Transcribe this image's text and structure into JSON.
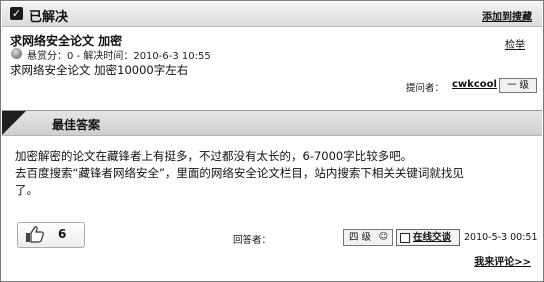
{
  "resolved": {
    "title": "已解决",
    "add_link": "添加到搜藏"
  },
  "question": {
    "title": "求网络安全论文  加密",
    "report_link": "检举",
    "meta": "悬赏分：0 - 解决时间：2010-6-3 10:55",
    "body": "求网络安全论文   加密10000字左右",
    "asker_label": "提问者：",
    "asker_name": "cwkcool",
    "asker_level": "一 级"
  },
  "best_answer": {
    "title": "最佳答案",
    "text_line1": "加密解密的论文在藏锋者上有挺多，不过都没有太长的，6-7000字比较多吧。",
    "text_line2": "去百度搜索“藏锋者网络安全”，里面的网络安全论文栏目，站内搜索下相关关键词就找见",
    "text_line3": "了。",
    "like_count": "6",
    "answerer_label": "回答者：",
    "answerer_level": "四 级",
    "online_label": "在线交谈",
    "date": "2010-5-3 00:51",
    "comment_link": "我来评论>>"
  },
  "icons": [
    "check-icon",
    "coin-icon",
    "thumb-up-icon",
    "chat-icon"
  ]
}
